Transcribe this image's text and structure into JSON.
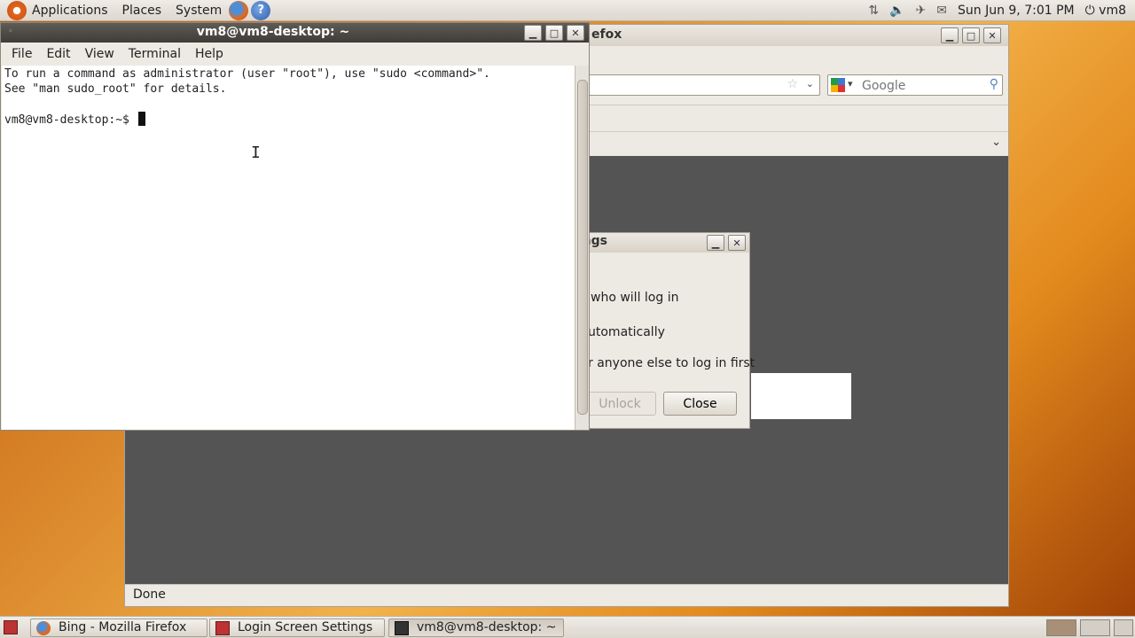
{
  "top_panel": {
    "menus": [
      "Applications",
      "Places",
      "System"
    ],
    "clock": "Sun Jun  9,  7:01 PM",
    "user": "vm8",
    "launchers": [
      "firefox-icon",
      "help-icon"
    ],
    "tray_icons": [
      "network-icon",
      "volume-icon",
      "bluetooth-icon",
      "mail-icon"
    ]
  },
  "firefox": {
    "title_fragment": "efox",
    "search_placeholder": "Google",
    "status": "Done"
  },
  "login_dialog": {
    "title_fragment": "ettings",
    "line1": "who will log in",
    "line2": "utomatically",
    "line3": "r anyone else to log in first",
    "unlock_label": "Unlock",
    "close_label": "Close"
  },
  "terminal": {
    "title": "vm8@vm8-desktop: ~",
    "menus": [
      "File",
      "Edit",
      "View",
      "Terminal",
      "Help"
    ],
    "line1": "To run a command as administrator (user \"root\"), use \"sudo <command>\".",
    "line2": "See \"man sudo_root\" for details.",
    "prompt": "vm8@vm8-desktop:~$ "
  },
  "taskbar": {
    "tasks": [
      {
        "label": "Bing - Mozilla Firefox",
        "icon": "firefox-icon"
      },
      {
        "label": "Login Screen Settings",
        "icon": "login-settings-icon"
      },
      {
        "label": "vm8@vm8-desktop: ~",
        "icon": "terminal-icon"
      }
    ]
  }
}
